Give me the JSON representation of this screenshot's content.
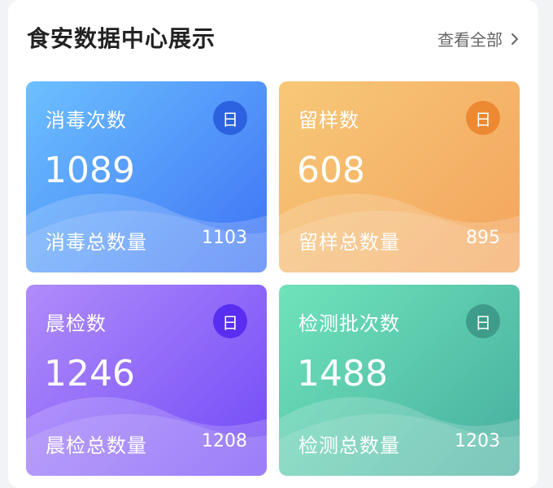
{
  "header": {
    "title": "食安数据中心展示",
    "view_all": "查看全部",
    "chevron_icon": "chevron-right-icon"
  },
  "cards": [
    {
      "label": "消毒次数",
      "value": "1089",
      "period": "日",
      "total_label": "消毒总数量",
      "total_value": "1103",
      "gradient_from": "#6cc0ff",
      "gradient_to": "#3d72f5",
      "badge_color": "#2c62df"
    },
    {
      "label": "留样数",
      "value": "608",
      "period": "日",
      "total_label": "留样总数量",
      "total_value": "895",
      "gradient_from": "#f7c878",
      "gradient_to": "#f3a45c",
      "badge_color": "#ec8a33"
    },
    {
      "label": "晨检数",
      "value": "1246",
      "period": "日",
      "total_label": "晨检总数量",
      "total_value": "1208",
      "gradient_from": "#b08cfa",
      "gradient_to": "#7149f7",
      "badge_color": "#5a2ef0"
    },
    {
      "label": "检测批次数",
      "value": "1488",
      "period": "日",
      "total_label": "检测总数量",
      "total_value": "1203",
      "gradient_from": "#6fe3ba",
      "gradient_to": "#47ae9f",
      "badge_color": "#3f9c8a"
    }
  ]
}
